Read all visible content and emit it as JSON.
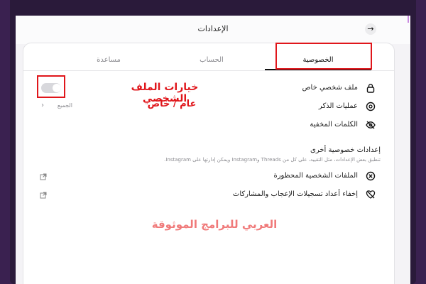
{
  "window": {
    "title": "الإعدادات"
  },
  "tabs": [
    {
      "label": "الخصوصية",
      "active": true
    },
    {
      "label": "الحساب",
      "active": false
    },
    {
      "label": "مساعدة",
      "active": false
    }
  ],
  "profile_privacy": {
    "label": "ملف شخصي خاص",
    "toggle_on": false
  },
  "mentions": {
    "label": "عمليات الذكر",
    "value": "الجميع"
  },
  "hidden_words": {
    "label": "الكلمات المخفية"
  },
  "other_privacy": {
    "heading": "إعدادات خصوصية أخرى",
    "description": "تنطبق بعض الإعدادات، مثل التقييد، على كل من Threads وInstagram ويمكن إدارتها على Instagram."
  },
  "blocked_profiles": {
    "label": "الملفات الشخصية المحظورة"
  },
  "hide_likes": {
    "label": "إخفاء أعداد تسجيلات الإعجاب والمشاركات"
  },
  "annotation": {
    "line1": "خيارات الملف  الشخصي",
    "line2": "عام / خاص"
  },
  "watermark": "العربي للبرامج الموثوقة",
  "colors": {
    "accent_red": "#e0161b",
    "watermark": "#f07a7a"
  }
}
